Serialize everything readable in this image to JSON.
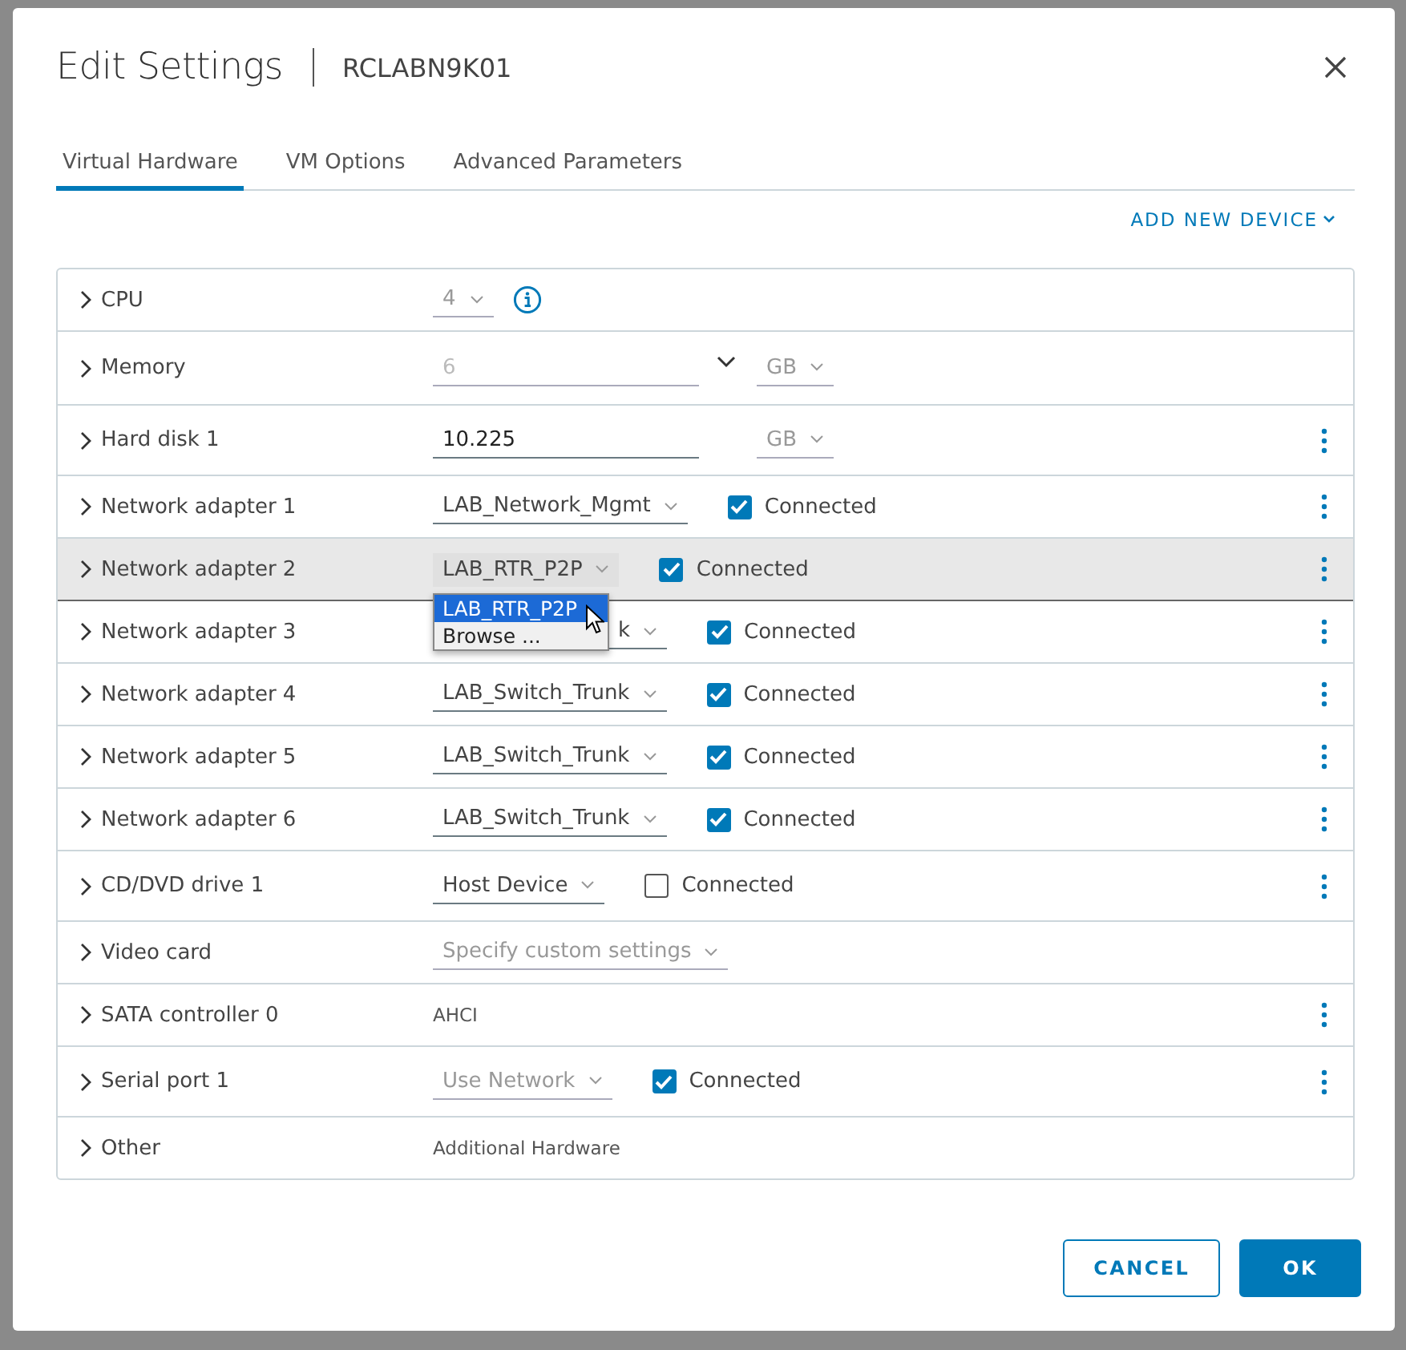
{
  "dialog": {
    "title": "Edit Settings",
    "subtitle": "RCLABN9K01"
  },
  "tabs": [
    {
      "label": "Virtual Hardware",
      "selected": true
    },
    {
      "label": "VM Options",
      "selected": false
    },
    {
      "label": "Advanced Parameters",
      "selected": false
    }
  ],
  "add_device": "ADD NEW DEVICE",
  "rows": [
    {
      "label": "CPU",
      "kind": "select_info",
      "value": "4",
      "selected": false,
      "menu": false
    },
    {
      "label": "Memory",
      "kind": "input_unit",
      "value": "6",
      "disabled": true,
      "unit": "GB",
      "selected": false,
      "menu": false
    },
    {
      "label": "Hard disk 1",
      "kind": "input_unit",
      "value": "10.225",
      "disabled": false,
      "unit": "GB",
      "selected": false,
      "menu": true
    },
    {
      "label": "Network adapter 1",
      "kind": "select_check",
      "value": "LAB_Network_Mgmt",
      "connected": true,
      "check_label": "Connected",
      "selected": false,
      "menu": true
    },
    {
      "label": "Network adapter 2",
      "kind": "select_check",
      "value": "LAB_RTR_P2P",
      "connected": true,
      "check_label": "Connected",
      "selected": true,
      "menu": true,
      "open": true,
      "options": [
        {
          "label": "LAB_RTR_P2P",
          "selected": true
        },
        {
          "label": "Browse ...",
          "selected": false
        }
      ]
    },
    {
      "label": "Network adapter 3",
      "kind": "select_check",
      "value": "k",
      "connected": true,
      "check_label": "Connected",
      "selected": false,
      "menu": true
    },
    {
      "label": "Network adapter 4",
      "kind": "select_check",
      "value": "LAB_Switch_Trunk",
      "connected": true,
      "check_label": "Connected",
      "selected": false,
      "menu": true
    },
    {
      "label": "Network adapter 5",
      "kind": "select_check",
      "value": "LAB_Switch_Trunk",
      "connected": true,
      "check_label": "Connected",
      "selected": false,
      "menu": true
    },
    {
      "label": "Network adapter 6",
      "kind": "select_check",
      "value": "LAB_Switch_Trunk",
      "connected": true,
      "check_label": "Connected",
      "selected": false,
      "menu": true
    },
    {
      "label": "CD/DVD drive 1",
      "kind": "select_check",
      "value": "Host Device",
      "connected": false,
      "check_label": "Connected",
      "selected": false,
      "menu": true
    },
    {
      "label": "Video card",
      "kind": "select",
      "value": "Specify custom settings",
      "disabled": true,
      "selected": false,
      "menu": false
    },
    {
      "label": "SATA controller 0",
      "kind": "text",
      "value": "AHCI",
      "selected": false,
      "menu": true
    },
    {
      "label": "Serial port 1",
      "kind": "select_check",
      "value": "Use Network",
      "disabled": true,
      "connected": true,
      "check_label": "Connected",
      "selected": false,
      "menu": true
    },
    {
      "label": "Other",
      "kind": "text",
      "value": "Additional Hardware",
      "selected": false,
      "menu": false
    }
  ],
  "buttons": [
    {
      "label": "CANCEL",
      "kind": "secondary"
    },
    {
      "label": "OK",
      "kind": "primary"
    }
  ]
}
